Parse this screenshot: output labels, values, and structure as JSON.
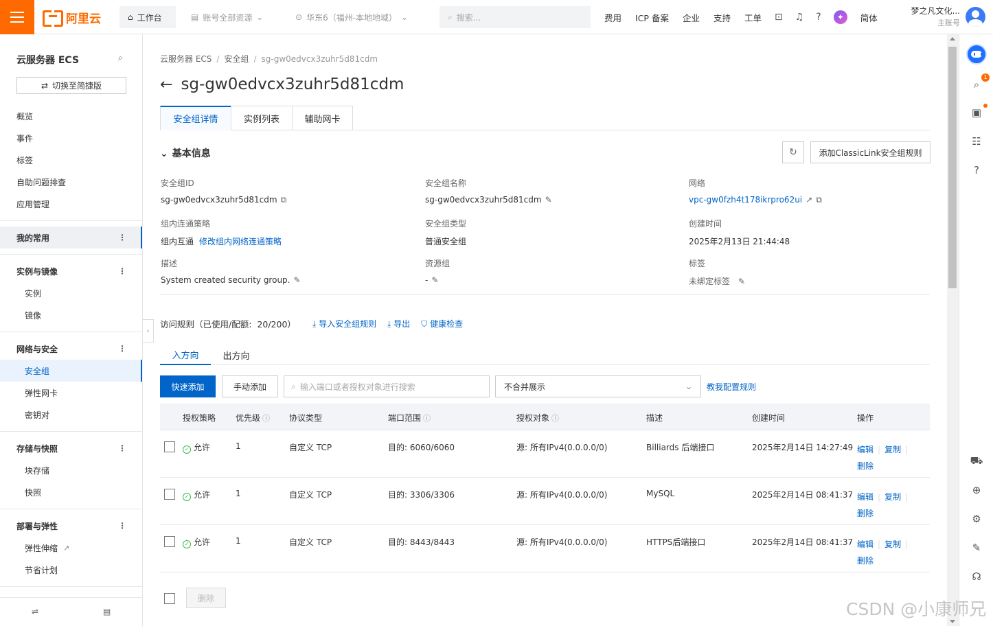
{
  "topbar": {
    "logo_text": "阿里云",
    "workbench": "工作台",
    "resources": "账号全部资源",
    "region": "华东6（福州-本地地域）",
    "search_placeholder": "搜索...",
    "nav": [
      "费用",
      "ICP 备案",
      "企业",
      "支持",
      "工单"
    ],
    "lang": "简体",
    "account_name": "梦之凡文化...",
    "account_role": "主账号"
  },
  "sidebar": {
    "title": "云服务器 ECS",
    "switch_label": "切换至简捷版",
    "top_items": [
      "概览",
      "事件",
      "标签",
      "自助问题排查",
      "应用管理"
    ],
    "groups": {
      "favorites": "我的常用",
      "instances": {
        "title": "实例与镜像",
        "items": [
          "实例",
          "镜像"
        ]
      },
      "network": {
        "title": "网络与安全",
        "items": [
          "安全组",
          "弹性网卡",
          "密钥对"
        ]
      },
      "storage": {
        "title": "存储与快照",
        "items": [
          "块存储",
          "快照"
        ]
      },
      "deploy": {
        "title": "部署与弹性",
        "items": [
          "弹性伸缩",
          "节省计划"
        ]
      }
    }
  },
  "breadcrumb": [
    "云服务器 ECS",
    "安全组",
    "sg-gw0edvcx3zuhr5d81cdm"
  ],
  "page_title": "sg-gw0edvcx3zuhr5d81cdm",
  "tabs": [
    "安全组详情",
    "实例列表",
    "辅助网卡"
  ],
  "basic": {
    "section_title": "基本信息",
    "add_classiclink": "添加ClassicLink安全组规则",
    "fields": {
      "sg_id": {
        "label": "安全组ID",
        "value": "sg-gw0edvcx3zuhr5d81cdm"
      },
      "sg_name": {
        "label": "安全组名称",
        "value": "sg-gw0edvcx3zuhr5d81cdm"
      },
      "network": {
        "label": "网络",
        "value": "vpc-gw0fzh4t178ikrpro62ui"
      },
      "policy": {
        "label": "组内连通策略",
        "value": "组内互通",
        "link": "修改组内网络连通策略"
      },
      "sg_type": {
        "label": "安全组类型",
        "value": "普通安全组"
      },
      "created": {
        "label": "创建时间",
        "value": "2025年2月13日 21:44:48"
      },
      "desc": {
        "label": "描述",
        "value": "System created security group."
      },
      "resgroup": {
        "label": "资源组",
        "value": "-"
      },
      "tags": {
        "label": "标签",
        "value": "未绑定标签"
      }
    }
  },
  "rules": {
    "header": "访问规则（已使用/配额:",
    "quota": "20/200）",
    "import": "导入安全组规则",
    "export": "导出",
    "health": "健康检查",
    "subtabs": [
      "入方向",
      "出方向"
    ],
    "quick_add": "快速添加",
    "manual_add": "手动添加",
    "search_placeholder": "输入端口或者授权对象进行搜索",
    "merge_select": "不合并展示",
    "teach": "教我配置规则",
    "columns": [
      "授权策略",
      "优先级",
      "协议类型",
      "端口范围",
      "授权对象",
      "描述",
      "创建时间",
      "操作"
    ],
    "rows": [
      {
        "policy": "允许",
        "priority": "1",
        "protocol": "自定义 TCP",
        "port": "目的: 6060/6060",
        "object": "源: 所有IPv4(0.0.0.0/0)",
        "desc": "Billiards 后端接口",
        "created": "2025年2月14日 14:27:49"
      },
      {
        "policy": "允许",
        "priority": "1",
        "protocol": "自定义 TCP",
        "port": "目的: 3306/3306",
        "object": "源: 所有IPv4(0.0.0.0/0)",
        "desc": "MySQL",
        "created": "2025年2月14日 08:41:37"
      },
      {
        "policy": "允许",
        "priority": "1",
        "protocol": "自定义 TCP",
        "port": "目的: 8443/8443",
        "object": "源: 所有IPv4(0.0.0.0/0)",
        "desc": "HTTPS后端接口",
        "created": "2025年2月14日 08:41:37"
      }
    ],
    "op_edit": "编辑",
    "op_copy": "复制",
    "op_delete": "删除",
    "batch_delete": "删除"
  },
  "right_rail": {
    "badge": "1"
  },
  "watermark": "CSDN @小康师兄",
  "colors": {
    "brand": "#ff6a00",
    "link": "#0064c8",
    "ok": "#3ab54a"
  }
}
